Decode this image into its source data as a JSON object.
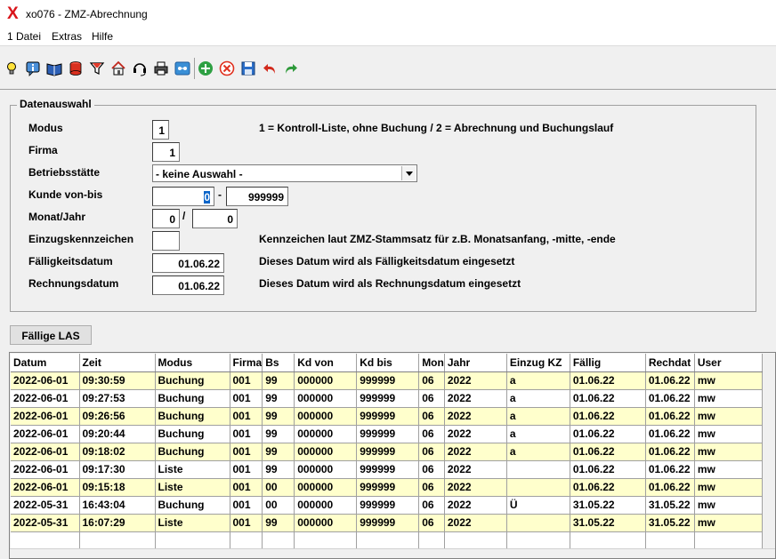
{
  "window": {
    "title": "xo076 - ZMZ-Abrechnung",
    "app_icon": "X"
  },
  "menu": [
    "1 Datei",
    "Extras",
    "Hilfe"
  ],
  "toolbar_icons": [
    "lightbulb-icon",
    "info-icon",
    "book-icon",
    "database-icon",
    "filter-icon",
    "home-icon",
    "headset-icon",
    "printer-icon",
    "screen-icon",
    "add-icon",
    "cancel-icon",
    "save-icon",
    "undo-icon",
    "redo-icon"
  ],
  "form": {
    "legend": "Datenauswahl",
    "modus_label": "Modus",
    "modus_value": "1",
    "modus_hint": "1 = Kontroll-Liste, ohne Buchung /  2 = Abrechnung und Buchungslauf",
    "firma_label": "Firma",
    "firma_value": "1",
    "betrieb_label": "Betriebsstätte",
    "betrieb_value": "- keine Auswahl -",
    "kunde_label": "Kunde von-bis",
    "kunde_von": "0",
    "kunde_sep": "-",
    "kunde_bis": "999999",
    "monat_label": "Monat/Jahr",
    "monat_value": "0",
    "monat_sep": "/",
    "jahr_value": "0",
    "einzug_label": "Einzugskennzeichen",
    "einzug_value": "",
    "einzug_hint": "Kennzeichen laut ZMZ-Stammsatz für z.B. Monatsanfang, -mitte, -ende",
    "faellig_label": "Fälligkeitsdatum",
    "faellig_value": "01.06.22",
    "faellig_hint": "Dieses Datum wird als Fälligkeitsdatum eingesetzt",
    "rechnung_label": "Rechnungsdatum",
    "rechnung_value": "01.06.22",
    "rechnung_hint": "Dieses Datum wird als Rechnungsdatum eingesetzt"
  },
  "button_las": "Fällige LAS",
  "table": {
    "headers": [
      "Datum",
      "Zeit",
      "Modus",
      "Firma",
      "Bs",
      "Kd von",
      "Kd bis",
      "Mon",
      "Jahr",
      "Einzug KZ",
      "Fällig",
      "Rechdat",
      "User"
    ],
    "rows": [
      [
        "2022-06-01",
        "09:30:59",
        "Buchung",
        "001",
        "99",
        "000000",
        "999999",
        "06",
        "2022",
        "a",
        "01.06.22",
        "01.06.22",
        "mw"
      ],
      [
        "2022-06-01",
        "09:27:53",
        "Buchung",
        "001",
        "99",
        "000000",
        "999999",
        "06",
        "2022",
        "a",
        "01.06.22",
        "01.06.22",
        "mw"
      ],
      [
        "2022-06-01",
        "09:26:56",
        "Buchung",
        "001",
        "99",
        "000000",
        "999999",
        "06",
        "2022",
        "a",
        "01.06.22",
        "01.06.22",
        "mw"
      ],
      [
        "2022-06-01",
        "09:20:44",
        "Buchung",
        "001",
        "99",
        "000000",
        "999999",
        "06",
        "2022",
        "a",
        "01.06.22",
        "01.06.22",
        "mw"
      ],
      [
        "2022-06-01",
        "09:18:02",
        "Buchung",
        "001",
        "99",
        "000000",
        "999999",
        "06",
        "2022",
        "a",
        "01.06.22",
        "01.06.22",
        "mw"
      ],
      [
        "2022-06-01",
        "09:17:30",
        "Liste",
        "001",
        "99",
        "000000",
        "999999",
        "06",
        "2022",
        "",
        "01.06.22",
        "01.06.22",
        "mw"
      ],
      [
        "2022-06-01",
        "09:15:18",
        "Liste",
        "001",
        "00",
        "000000",
        "999999",
        "06",
        "2022",
        "",
        "01.06.22",
        "01.06.22",
        "mw"
      ],
      [
        "2022-05-31",
        "16:43:04",
        "Buchung",
        "001",
        "00",
        "000000",
        "999999",
        "06",
        "2022",
        "Ü",
        "31.05.22",
        "31.05.22",
        "mw"
      ],
      [
        "2022-05-31",
        "16:07:29",
        "Liste",
        "001",
        "99",
        "000000",
        "999999",
        "06",
        "2022",
        "",
        "31.05.22",
        "31.05.22",
        "mw"
      ]
    ]
  }
}
